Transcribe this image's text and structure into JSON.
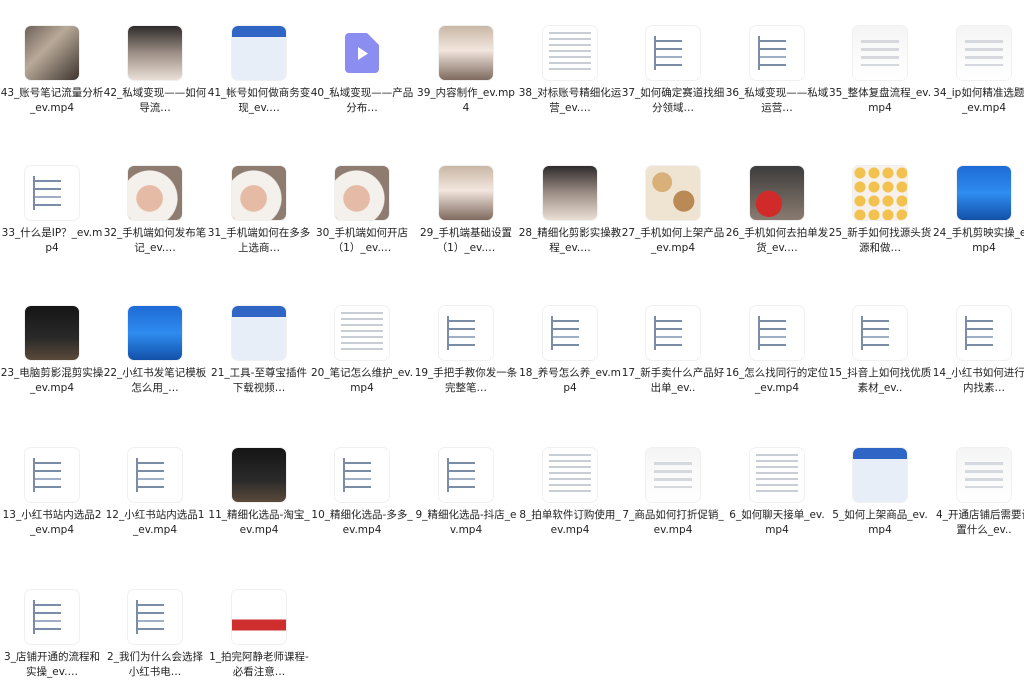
{
  "files": [
    {
      "label": "43_账号笔记流量分析_ev.mp4",
      "thumb": "photo"
    },
    {
      "label": "42_私域变现——如何导流…",
      "thumb": "phone"
    },
    {
      "label": "41_帐号如何做商务变现_ev.…",
      "thumb": "screen"
    },
    {
      "label": "40_私域变现——产品分布…",
      "thumb": "video-file-icon"
    },
    {
      "label": "39_内容制作_ev.mp4",
      "thumb": "phone2"
    },
    {
      "label": "38_对标账号精细化运营_ev.…",
      "thumb": "doc"
    },
    {
      "label": "37_如何确定赛道找细分领域…",
      "thumb": "map"
    },
    {
      "label": "36_私域变现——私域运营…",
      "thumb": "map"
    },
    {
      "label": "35_整体复盘流程_ev.mp4",
      "thumb": "chart"
    },
    {
      "label": "34_ip如何精准选题？_ev.mp4",
      "thumb": "chart"
    },
    {
      "label": "33_什么是IP？_ev.mp4",
      "thumb": "map"
    },
    {
      "label": "32_手机端如何发布笔记_ev.…",
      "thumb": "hand"
    },
    {
      "label": "31_手机端如何在多多上选商…",
      "thumb": "hand"
    },
    {
      "label": "30_手机端如何开店（1）_ev.…",
      "thumb": "hand"
    },
    {
      "label": "29_手机端基础设置（1）_ev.…",
      "thumb": "phone2"
    },
    {
      "label": "28_精细化剪影实操教程_ev.…",
      "thumb": "phone"
    },
    {
      "label": "27_手机如何上架产品_ev.mp4",
      "thumb": "food"
    },
    {
      "label": "26_手机如何去拍单发货_ev.…",
      "thumb": "red"
    },
    {
      "label": "25_新手如何找源头货源和做…",
      "thumb": "icons"
    },
    {
      "label": "24_手机剪映实操_ev.mp4",
      "thumb": "blue"
    },
    {
      "label": "23_电脑剪影混剪实操_ev.mp4",
      "thumb": "dark"
    },
    {
      "label": "22_小红书发笔记模板怎么用_…",
      "thumb": "blue"
    },
    {
      "label": "21_工具-至尊宝插件下载视频…",
      "thumb": "screen"
    },
    {
      "label": "20_笔记怎么维护_ev.mp4",
      "thumb": "doc"
    },
    {
      "label": "19_手把手教你发一条完整笔…",
      "thumb": "map"
    },
    {
      "label": "18_养号怎么养_ev.mp4",
      "thumb": "map"
    },
    {
      "label": "17_新手卖什么产品好出单_ev..",
      "thumb": "map"
    },
    {
      "label": "16_怎么找同行的定位_ev.mp4",
      "thumb": "map"
    },
    {
      "label": "15_抖音上如何找优质素材_ev..",
      "thumb": "map"
    },
    {
      "label": "14_小红书如何进行站内找素…",
      "thumb": "map"
    },
    {
      "label": "13_小红书站内选品2_ev.mp4",
      "thumb": "map"
    },
    {
      "label": "12_小红书站内选品1_ev.mp4",
      "thumb": "map"
    },
    {
      "label": "11_精细化选品-淘宝_ev.mp4",
      "thumb": "dark"
    },
    {
      "label": "10_精细化选品-多多_ev.mp4",
      "thumb": "map"
    },
    {
      "label": "9_精细化选品-抖店_ev.mp4",
      "thumb": "map"
    },
    {
      "label": "8_拍单软件订购使用_ev.mp4",
      "thumb": "doc"
    },
    {
      "label": "7_商品如何打折促销_ev.mp4",
      "thumb": "chart"
    },
    {
      "label": "6_如何聊天接单_ev.mp4",
      "thumb": "doc"
    },
    {
      "label": "5_如何上架商品_ev.mp4",
      "thumb": "screen"
    },
    {
      "label": "4_开通店铺后需要设置什么_ev..",
      "thumb": "chart"
    },
    {
      "label": "3_店铺开通的流程和实操_ev.…",
      "thumb": "map"
    },
    {
      "label": "2_我们为什么会选择小红书电…",
      "thumb": "map"
    },
    {
      "label": "1_拍完阿静老师课程-必看注意…",
      "thumb": "card"
    }
  ],
  "colors": {
    "background": "#ffffff",
    "file_icon": "#8b8df0"
  }
}
